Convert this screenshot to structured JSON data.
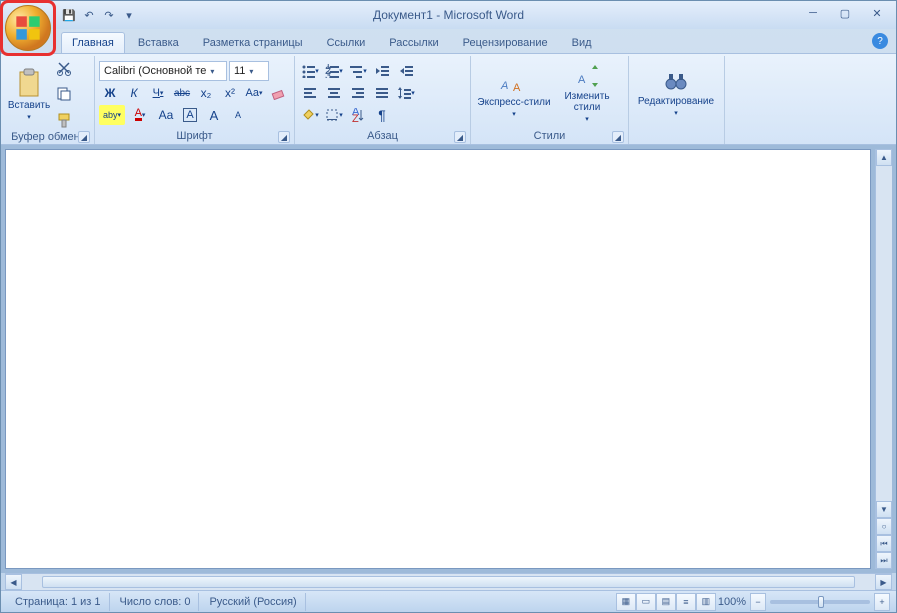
{
  "title": "Документ1 - Microsoft Word",
  "tabs": [
    "Главная",
    "Вставка",
    "Разметка страницы",
    "Ссылки",
    "Рассылки",
    "Рецензирование",
    "Вид"
  ],
  "active_tab": 0,
  "clipboard": {
    "paste": "Вставить",
    "label": "Буфер обмена"
  },
  "font": {
    "name": "Calibri (Основной те",
    "size": "11",
    "label": "Шрифт",
    "bold": "Ж",
    "italic": "К",
    "underline": "Ч",
    "strike": "abc",
    "sub": "x₂",
    "sup": "x²",
    "caseBtn": "Aa",
    "clear": "⌫",
    "highlight": "aby",
    "color": "A",
    "textAa": "Aa",
    "growA": "A",
    "shrinkA": "A"
  },
  "paragraph": {
    "label": "Абзац"
  },
  "styles": {
    "quick": "Экспресс-стили",
    "change": "Изменить\nстили",
    "label": "Стили"
  },
  "editing": {
    "label": "Редактирование",
    "find": "Редактирование"
  },
  "status": {
    "page": "Страница: 1 из 1",
    "words": "Число слов: 0",
    "lang": "Русский (Россия)",
    "zoom": "100%"
  },
  "icons": {
    "save": "💾",
    "undo": "↶",
    "redo": "↷",
    "qat_more": "▾"
  }
}
